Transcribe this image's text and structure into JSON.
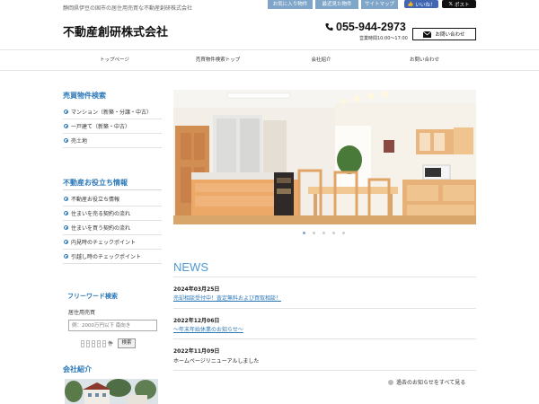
{
  "header": {
    "tagline": "静岡県伊豆の国市の居住用売買な不動産創研株式会社",
    "top_links": [
      "お気に入り物件",
      "最近見た物件",
      "サイトマップ"
    ],
    "like_label": "いいね！",
    "post_label": "ポスト",
    "company_name": "不動産創研株式会社",
    "phone": "055-944-2973",
    "hours": "営業時間10:00～17:00",
    "contact_label": "お問い合わせ"
  },
  "nav": {
    "items": [
      "トップページ",
      "売買物件検索トップ",
      "会社紹介",
      "お問い合わせ"
    ]
  },
  "sidebar": {
    "search_title": "売買物件検索",
    "search_items": [
      "マンション（新築・分譲・中古）",
      "一戸建て（新築・中古）",
      "売土地"
    ],
    "useful_title": "不動産お役立ち情報",
    "useful_items": [
      "不動産お役立ち情報",
      "住まいを売る契約の流れ",
      "住まいを買う契約の流れ",
      "内見時のチェックポイント",
      "引越し時のチェックポイント"
    ],
    "freeword_title": "フリーワード検索",
    "freeword_label": "居住用売買",
    "freeword_placeholder": "例：2000万円以下 南向き",
    "ken_label": "件",
    "ken_dash": "-",
    "search_button": "検索",
    "company_title": "会社紹介"
  },
  "slider": {
    "active_index": 0,
    "count": 5
  },
  "news": {
    "title": "NEWS",
    "items": [
      {
        "date": "2024年03月25日",
        "text": "売却相談受付中！査定無料および買取相談！",
        "link": true
      },
      {
        "date": "2022年12月06日",
        "text": "～年末年始休業のお知らせ～",
        "link": true
      },
      {
        "date": "2022年11月09日",
        "text": "ホームページリニューアルしました",
        "link": false
      }
    ],
    "all_label": "過去のお知らせをすべて見る"
  },
  "colors": {
    "accent": "#2b78b8",
    "top_link_bg": "#7fa6c9",
    "news_title": "#4f9ad6"
  }
}
